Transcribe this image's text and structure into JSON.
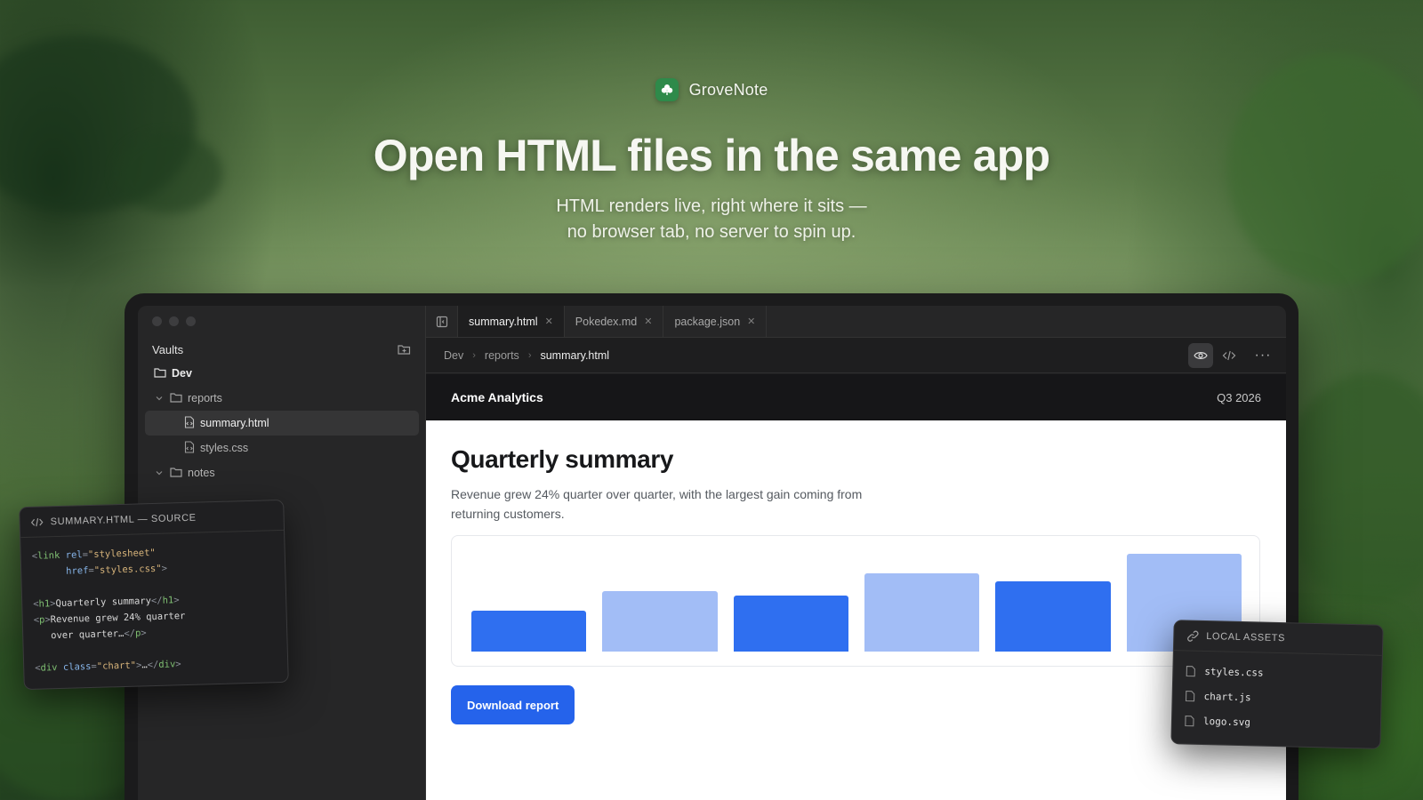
{
  "brand": {
    "name": "GroveNote"
  },
  "hero": {
    "title": "Open HTML files in the same app",
    "subtitle_line1": "HTML renders live, right where it sits —",
    "subtitle_line2": "no browser tab, no server to spin up."
  },
  "sidebar": {
    "title": "Vaults",
    "tree": [
      {
        "label": "Dev",
        "type": "folder",
        "level": 0
      },
      {
        "label": "reports",
        "type": "folder",
        "level": 1,
        "expanded": true
      },
      {
        "label": "summary.html",
        "type": "file",
        "level": 2,
        "selected": true
      },
      {
        "label": "styles.css",
        "type": "file",
        "level": 2
      },
      {
        "label": "notes",
        "type": "folder",
        "level": 1,
        "expanded": true
      }
    ]
  },
  "tabs": [
    {
      "label": "summary.html",
      "active": true
    },
    {
      "label": "Pokedex.md",
      "active": false
    },
    {
      "label": "package.json",
      "active": false
    }
  ],
  "breadcrumb": [
    "Dev",
    "reports",
    "summary.html"
  ],
  "preview": {
    "company": "Acme Analytics",
    "period": "Q3 2026",
    "title": "Quarterly summary",
    "description": "Revenue grew 24% quarter over quarter, with the largest gain coming from returning customers.",
    "button_label": "Download report",
    "chart_data": {
      "type": "bar",
      "values": [
        42,
        62,
        57,
        80,
        72,
        100
      ],
      "ylim": [
        0,
        100
      ],
      "colors": [
        "#2f6ff0",
        "#a2bdf6",
        "#2f6ff0",
        "#a2bdf6",
        "#2f6ff0",
        "#a2bdf6"
      ],
      "grid": false,
      "legend": "none"
    }
  },
  "source_card": {
    "title": "SUMMARY.HTML — SOURCE"
  },
  "assets_card": {
    "title": "LOCAL ASSETS",
    "items": [
      "styles.css",
      "chart.js",
      "logo.svg"
    ]
  },
  "colors": {
    "accent": "#2563eb",
    "brand_green": "#2e8a4a",
    "app_bg": "#1e1e1f"
  }
}
